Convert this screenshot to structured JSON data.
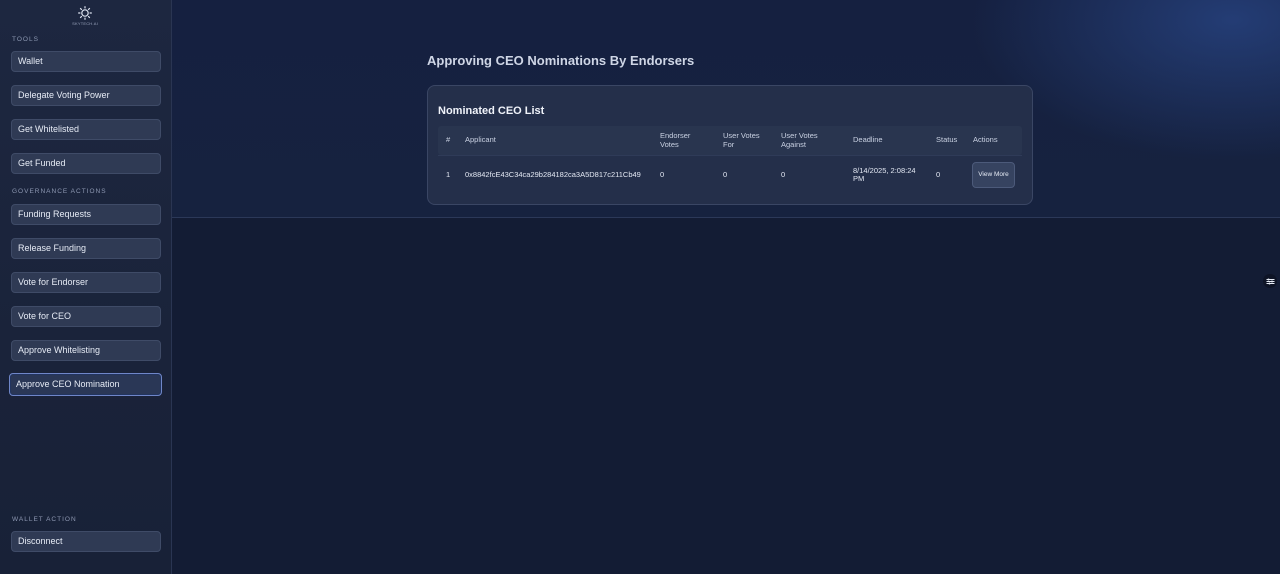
{
  "sidebar": {
    "logo_text": "SKYTECH.AI",
    "sections": {
      "tools": "TOOLS",
      "governance": "GOVERNANCE ACTIONS",
      "wallet": "WALLET ACTION"
    },
    "items": [
      {
        "label": "Wallet"
      },
      {
        "label": "Delegate Voting Power"
      },
      {
        "label": "Get Whitelisted"
      },
      {
        "label": "Get Funded"
      },
      {
        "label": "Funding Requests"
      },
      {
        "label": "Release Funding"
      },
      {
        "label": "Vote for Endorser"
      },
      {
        "label": "Vote for CEO"
      },
      {
        "label": "Approve Whitelisting"
      },
      {
        "label": "Approve CEO Nomination",
        "active": true
      }
    ],
    "disconnect_label": "Disconnect"
  },
  "main": {
    "page_title": "Approving CEO Nominations By Endorsers",
    "card": {
      "title": "Nominated CEO List",
      "columns": {
        "index": "#",
        "applicant": "Applicant",
        "endorser_votes": "Endorser Votes",
        "votes_for": "User Votes For",
        "votes_against": "User Votes Against",
        "deadline": "Deadline",
        "status": "Status",
        "actions": "Actions"
      },
      "rows": [
        {
          "index": "1",
          "applicant": "0x8842fcE43C34ca29b284182ca3A5D817c211Cb49",
          "endorser_votes": "0",
          "votes_for": "0",
          "votes_against": "0",
          "deadline": "8/14/2025, 2:08:24 PM",
          "status": "0",
          "action_label": "View More"
        }
      ]
    }
  },
  "icons": {
    "logo": "gear-logo-icon",
    "floating": "sliders-icon"
  }
}
